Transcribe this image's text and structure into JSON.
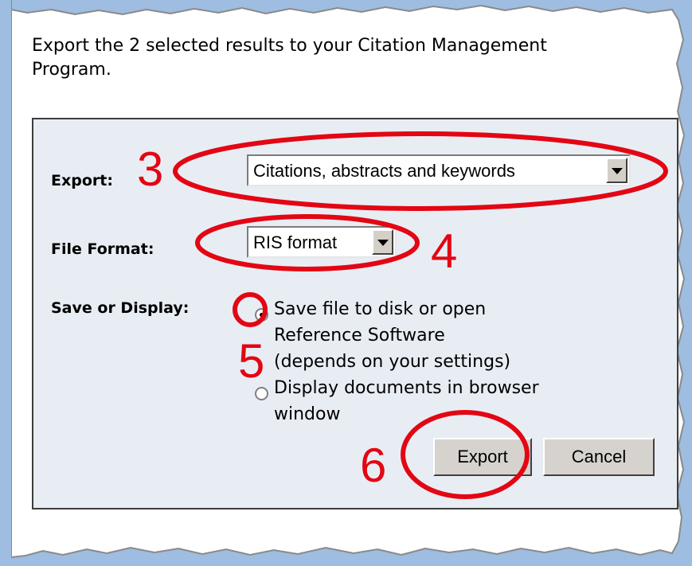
{
  "dialog": {
    "intro_text": "Export the 2 selected results to your Citation Management Program.",
    "export_label": "Export:",
    "export_select": {
      "value": "Citations, abstracts and keywords"
    },
    "file_format_label": "File Format:",
    "file_format_select": {
      "value": "RIS format"
    },
    "save_or_display_label": "Save or Display:",
    "options": [
      {
        "lines": [
          "Save file to disk or open",
          "Reference Software",
          "(depends on your settings)"
        ],
        "selected": true
      },
      {
        "lines": [
          "Display documents in browser",
          "window"
        ],
        "selected": false
      }
    ],
    "export_button": "Export",
    "cancel_button": "Cancel"
  },
  "annotations": {
    "step3": "3",
    "step4": "4",
    "step5": "5",
    "step6": "6",
    "color": "#e30613"
  },
  "colors": {
    "page_background": "#9ebde0",
    "panel_background": "#e8edf4"
  }
}
